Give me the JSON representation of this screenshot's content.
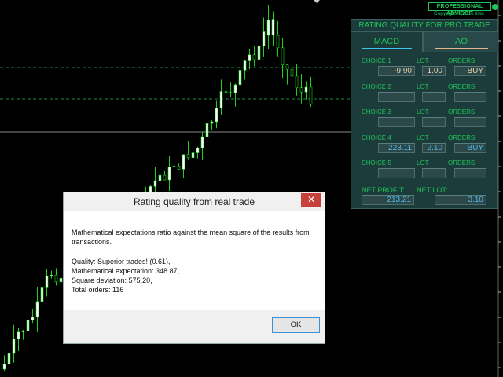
{
  "header": {
    "badge": "PROFESSIONAL ADVISOR",
    "copyright": "Copyright © 2015 lilita"
  },
  "panel": {
    "title": "RATING QUALITY FOR PRO TRADE",
    "tabs": [
      {
        "label": "MACD",
        "underline": "#3ec3ef"
      },
      {
        "label": "AO",
        "underline": "#e9b68a"
      }
    ],
    "col_lot": "LOT",
    "col_orders": "ORDERS",
    "choices": [
      {
        "label": "CHOICE 1",
        "value": "-9.90",
        "lot": "1.00",
        "order": "BUY",
        "color": "#e3d2b0"
      },
      {
        "label": "CHOICE 2",
        "value": "",
        "lot": "",
        "order": "",
        "color": "#4fb8e8"
      },
      {
        "label": "CHOICE 3",
        "value": "",
        "lot": "",
        "order": "",
        "color": "#4fb8e8"
      },
      {
        "label": "CHOICE 4",
        "value": "223.11",
        "lot": "2.10",
        "order": "BUY",
        "color": "#4fb8e8"
      },
      {
        "label": "CHOICE 5",
        "value": "",
        "lot": "",
        "order": "",
        "color": "#4fb8e8"
      }
    ],
    "net_profit_label": "NET PROFIT:",
    "net_profit": "213.21",
    "net_lot_label": "NET LOT:",
    "net_lot": "3.10"
  },
  "dialog": {
    "title": "Rating quality from real trade",
    "close": "✕",
    "description": "Mathematical expectations ratio against the mean square of the results from transactions.",
    "lines": [
      "Quality: Superior trades! (0.61),",
      "Mathematical expectation: 348.87,",
      "Square deviation: 575.20,",
      "Total orders: 116"
    ],
    "ok": "OK"
  }
}
